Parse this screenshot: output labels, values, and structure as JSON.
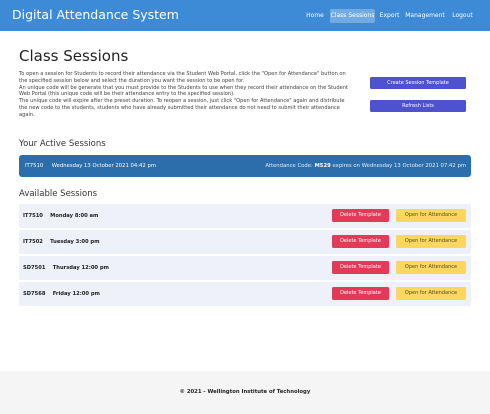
{
  "app": {
    "title": "Digital Attendance System"
  },
  "nav": {
    "items": [
      {
        "label": "Home"
      },
      {
        "label": "Class Sessions"
      },
      {
        "label": "Export"
      },
      {
        "label": "Management"
      },
      {
        "label": "Logout"
      }
    ],
    "active": "Class Sessions"
  },
  "page": {
    "title": "Class Sessions",
    "intro": [
      "To open a session for Students to record their attendance via the Student Web Portal, click the \"Open for Attendance\" button on the specified session below and select the duration you want the session to be open for.",
      "An unique code will be generate that you must provide to the Students to use when they record their attendance on the Student Web Portal (this unique code will be their attendance entry to the specified session).",
      "The unique code will expire after the preset duration. To reopen a session, just click \"Open for Attendance\" again and distribute the new code to the students, students who have already submitted their attendance do not need to submit their attendance again."
    ],
    "buttons": {
      "create": "Create Session Template",
      "refresh": "Refresh Lists"
    }
  },
  "active_sessions": {
    "heading": "Your Active Sessions",
    "items": [
      {
        "course": "IT7510",
        "datetime": "Wednesday 13 October 2021 04:42 pm",
        "code_label": "Attendance Code:",
        "code": "M529",
        "expires": "expires on Wednesday 13 October 2021 07:42 pm"
      }
    ]
  },
  "available_sessions": {
    "heading": "Available Sessions",
    "delete_label": "Delete Template",
    "open_label": "Open for Attendance",
    "items": [
      {
        "course": "IT7510",
        "time": "Monday 8:00 am"
      },
      {
        "course": "IT7502",
        "time": "Tuesday 3:00 pm"
      },
      {
        "course": "SD7501",
        "time": "Thursday 12:00 pm"
      },
      {
        "course": "SD7568",
        "time": "Friday 12:00 pm"
      }
    ]
  },
  "footer": {
    "text": "© 2021 - Wellington Institute of Technology"
  },
  "colors": {
    "navbar": "#3d8bd6",
    "primary_button": "#4f52cf",
    "active_bar": "#2c6eab",
    "delete_button": "#e23b5a",
    "open_button": "#fbd760",
    "session_row": "#eef0fa"
  }
}
